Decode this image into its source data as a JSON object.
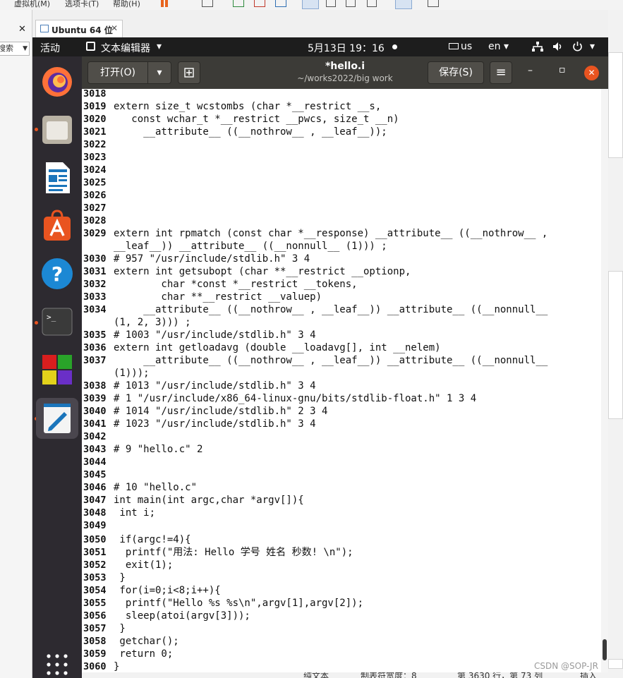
{
  "host": {
    "menu": [
      "虚拟机(M)",
      "选项卡(T)",
      "帮助(H)"
    ],
    "search_placeholder": "搜索",
    "close_glyph": "✕",
    "vm_tab_title": "Ubuntu 64 位",
    "vm_tab_close": "✕"
  },
  "topbar": {
    "activities": "活动",
    "app_menu": "文本编辑器",
    "app_menu_arrow": "▾",
    "datetime": "5月13日  19：16",
    "keyboard": "us",
    "language": "en",
    "language_arrow": "▾",
    "system_arrow": "▾"
  },
  "dock": {
    "items": [
      {
        "name": "firefox",
        "running": false
      },
      {
        "name": "files",
        "running": true
      },
      {
        "name": "libreoffice-writer",
        "running": false
      },
      {
        "name": "ubuntu-software",
        "running": false
      },
      {
        "name": "help",
        "running": false
      },
      {
        "name": "terminal",
        "running": true
      },
      {
        "name": "app-center-blocks",
        "running": false
      },
      {
        "name": "text-editor",
        "running": true
      }
    ],
    "terminal_prompt": ">_",
    "help_glyph": "?",
    "grid_label": "显示应用程序"
  },
  "headerbar": {
    "open_label": "打开(O)",
    "open_menu_arrow": "▾",
    "title": "*hello.i",
    "subtitle": "~/works2022/big work",
    "save_label": "保存(S)",
    "menu_glyph": "≡",
    "minimize_glyph": "–",
    "maximize_glyph": "▫",
    "close_glyph": "✕"
  },
  "editor": {
    "lines": [
      {
        "n": "3018",
        "text": ""
      },
      {
        "n": "3019",
        "text": "extern size_t wcstombs (char *__restrict __s,"
      },
      {
        "n": "3020",
        "text": "   const wchar_t *__restrict __pwcs, size_t __n)"
      },
      {
        "n": "3021",
        "text": "     __attribute__ ((__nothrow__ , __leaf__));"
      },
      {
        "n": "3022",
        "text": ""
      },
      {
        "n": "3023",
        "text": ""
      },
      {
        "n": "3024",
        "text": ""
      },
      {
        "n": "3025",
        "text": ""
      },
      {
        "n": "3026",
        "text": ""
      },
      {
        "n": "3027",
        "text": ""
      },
      {
        "n": "3028",
        "text": ""
      },
      {
        "n": "3029",
        "text": "extern int rpmatch (const char *__response) __attribute__ ((__nothrow__ ,"
      },
      {
        "n": "",
        "text": "__leaf__)) __attribute__ ((__nonnull__ (1))) ;"
      },
      {
        "n": "3030",
        "text": "# 957 \"/usr/include/stdlib.h\" 3 4"
      },
      {
        "n": "3031",
        "text": "extern int getsubopt (char **__restrict __optionp,"
      },
      {
        "n": "3032",
        "text": "        char *const *__restrict __tokens,"
      },
      {
        "n": "3033",
        "text": "        char **__restrict __valuep)"
      },
      {
        "n": "3034",
        "text": "     __attribute__ ((__nothrow__ , __leaf__)) __attribute__ ((__nonnull__"
      },
      {
        "n": "",
        "text": "(1, 2, 3))) ;"
      },
      {
        "n": "3035",
        "text": "# 1003 \"/usr/include/stdlib.h\" 3 4"
      },
      {
        "n": "3036",
        "text": "extern int getloadavg (double __loadavg[], int __nelem)"
      },
      {
        "n": "3037",
        "text": "     __attribute__ ((__nothrow__ , __leaf__)) __attribute__ ((__nonnull__"
      },
      {
        "n": "",
        "text": "(1)));"
      },
      {
        "n": "3038",
        "text": "# 1013 \"/usr/include/stdlib.h\" 3 4"
      },
      {
        "n": "3039",
        "text": "# 1 \"/usr/include/x86_64-linux-gnu/bits/stdlib-float.h\" 1 3 4"
      },
      {
        "n": "3040",
        "text": "# 1014 \"/usr/include/stdlib.h\" 2 3 4"
      },
      {
        "n": "3041",
        "text": "# 1023 \"/usr/include/stdlib.h\" 3 4"
      },
      {
        "n": "3042",
        "text": ""
      },
      {
        "n": "3043",
        "text": "# 9 \"hello.c\" 2"
      },
      {
        "n": "3044",
        "text": ""
      },
      {
        "n": "3045",
        "text": ""
      },
      {
        "n": "3046",
        "text": "# 10 \"hello.c\""
      },
      {
        "n": "3047",
        "text": "int main(int argc,char *argv[]){"
      },
      {
        "n": "3048",
        "text": " int i;"
      },
      {
        "n": "3049",
        "text": ""
      },
      {
        "n": "3050",
        "text": " if(argc!=4){"
      },
      {
        "n": "3051",
        "text": "  printf(\"用法: Hello 学号 姓名 秒数! \\n\");"
      },
      {
        "n": "3052",
        "text": "  exit(1);"
      },
      {
        "n": "3053",
        "text": " }"
      },
      {
        "n": "3054",
        "text": " for(i=0;i<8;i++){"
      },
      {
        "n": "3055",
        "text": "  printf(\"Hello %s %s\\n\",argv[1],argv[2]);"
      },
      {
        "n": "3056",
        "text": "  sleep(atoi(argv[3]));"
      },
      {
        "n": "3057",
        "text": " }"
      },
      {
        "n": "3058",
        "text": " getchar();"
      },
      {
        "n": "3059",
        "text": " return 0;"
      },
      {
        "n": "3060",
        "text": "}"
      }
    ]
  },
  "statusbar": {
    "mode": "纯文本",
    "tab_width": "制表符宽度：8",
    "position": "第 3630 行，第 73 列",
    "insert": "插入"
  },
  "watermark": "CSDN @SOP-JR",
  "colors": {
    "topbar": "#1d1d1d",
    "dock": "#2d2a30",
    "headerbar": "#3c3b37",
    "close_button": "#e95420",
    "running_dot": "#e95420"
  }
}
